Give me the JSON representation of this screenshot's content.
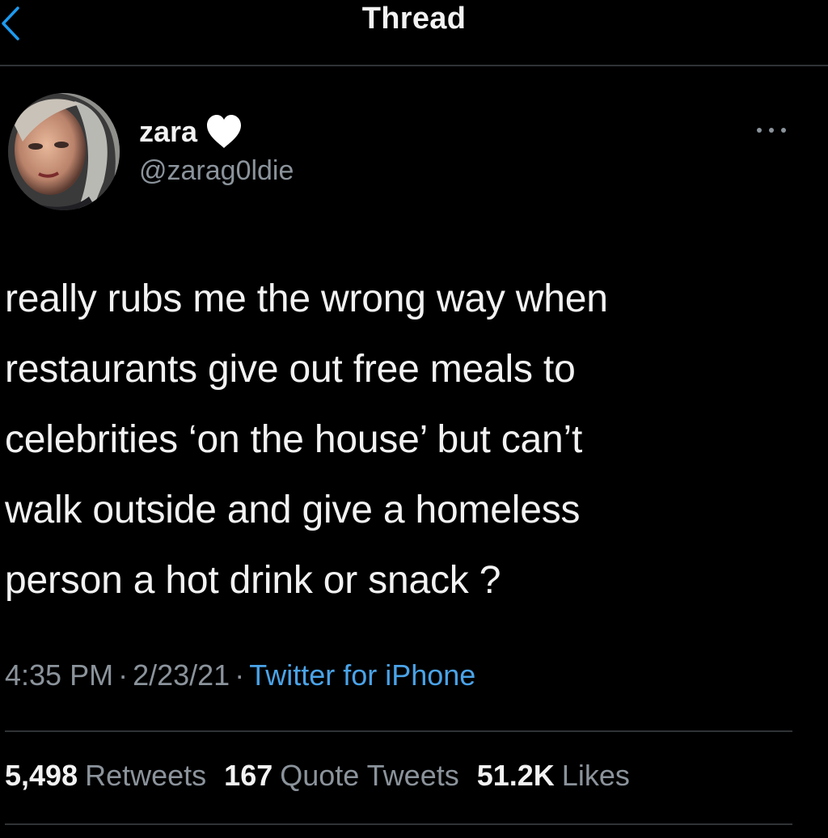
{
  "header": {
    "title": "Thread"
  },
  "author": {
    "display_name": "zara",
    "handle": "@zarag0ldie",
    "badge_icon": "white-heart-icon"
  },
  "tweet": {
    "lines": [
      "really rubs me the wrong way when",
      "restaurants give out free meals to",
      "celebrities ‘on the house’ but can’t",
      "walk outside and give a homeless",
      "person a hot drink or snack ?"
    ]
  },
  "meta": {
    "time": "4:35 PM",
    "separator": "·",
    "date": "2/23/21",
    "source": "Twitter for iPhone"
  },
  "stats": {
    "retweets": {
      "count": "5,498",
      "label": "Retweets"
    },
    "quotes": {
      "count": "167",
      "label": "Quote Tweets"
    },
    "likes": {
      "count": "51.2K",
      "label": "Likes"
    }
  },
  "colors": {
    "background": "#000000",
    "text": "#f2f2f2",
    "secondary_text": "#8b939b",
    "link": "#4aa3e8",
    "divider": "#2f3336"
  }
}
